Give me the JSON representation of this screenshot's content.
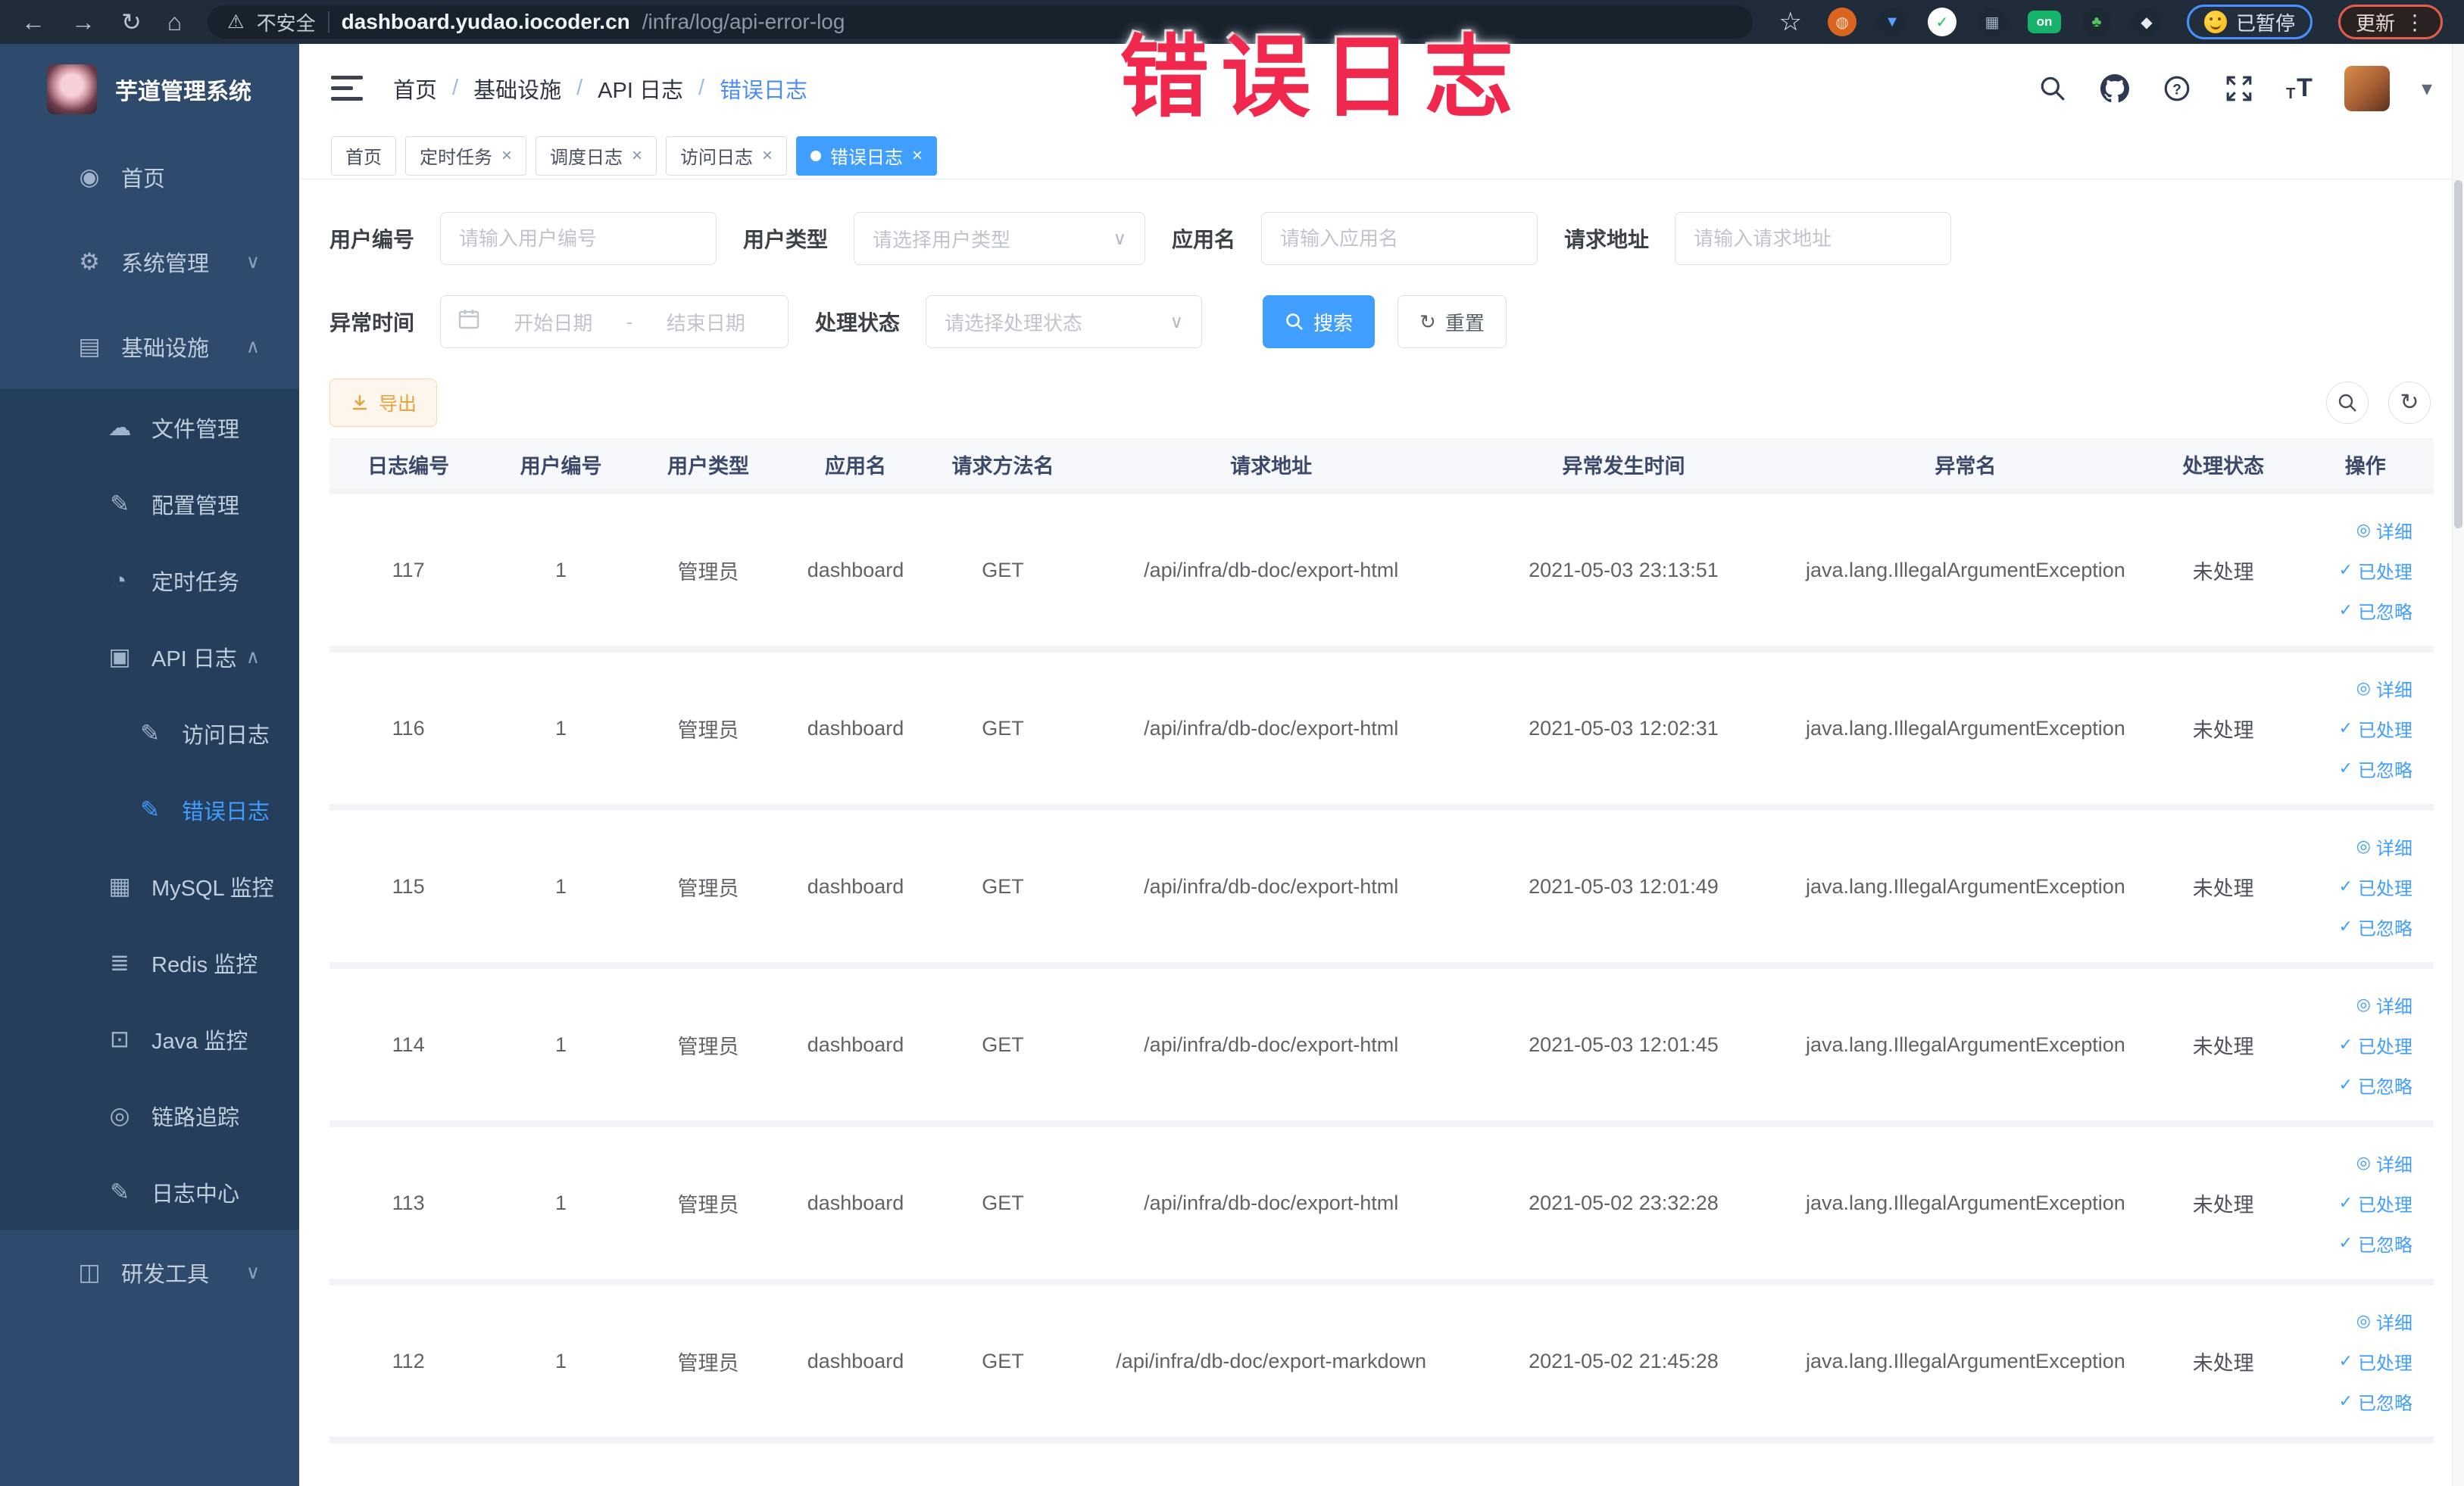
{
  "colors": {
    "primary": "#409eff",
    "warning_text": "#e6a23c",
    "warning_bg": "#fdf6ec",
    "warning_border": "#f5dab1",
    "sidebar_bg": "#2e4a6c",
    "sidebar_submenu_bg": "#243e5c",
    "browser_bar_bg": "#202c3a",
    "watermark": "#f1284d",
    "active_tab_bg": "#409eff"
  },
  "watermark": {
    "text": "错误日志"
  },
  "browser": {
    "back_glyph": "←",
    "forward_glyph": "→",
    "reload_glyph": "↻",
    "home_glyph": "⌂",
    "warning_glyph": "⚠",
    "security_label": "不安全",
    "url_host": "dashboard.yudao.iocoder.cn",
    "url_path": "/infra/log/api-error-log",
    "bookmark_star_glyph": "☆",
    "extensions": [
      {
        "name": "ext-orange-icon",
        "glyph": "◍",
        "bg": "#d9651f",
        "fg": "#ffd9c0",
        "shape": "circle"
      },
      {
        "name": "ext-shield-icon",
        "glyph": "▼",
        "bg": "#1d2935",
        "fg": "#5aa0ff",
        "shape": "circle"
      },
      {
        "name": "ext-green-check-icon",
        "glyph": "✓",
        "bg": "#ffffff",
        "fg": "#21c15c",
        "shape": "circle"
      },
      {
        "name": "ext-grid-icon",
        "glyph": "▦",
        "bg": "#1d2935",
        "fg": "#9fb2c8",
        "shape": "circle"
      },
      {
        "name": "ext-on-badge-icon",
        "glyph": "on",
        "bg": "#17b26a",
        "fg": "#ffffff",
        "shape": "badge"
      },
      {
        "name": "ext-sprout-icon",
        "glyph": "♣",
        "bg": "#1d2935",
        "fg": "#57c65f",
        "shape": "circle"
      },
      {
        "name": "ext-puzzle-icon",
        "glyph": "◆",
        "bg": "#1d2935",
        "fg": "#e8ecf1",
        "shape": "circle"
      }
    ],
    "paused_label": "已暂停",
    "update_label": "更新",
    "menu_dots_glyph": "⋮"
  },
  "sidebar": {
    "title": "芋道管理系统",
    "items": [
      {
        "key": "home",
        "label": "首页",
        "icon": "home-gauge-icon",
        "glyph": "◉",
        "depth": 0,
        "dark": false,
        "active": false,
        "chevron": null
      },
      {
        "key": "system",
        "label": "系统管理",
        "icon": "gear-icon",
        "glyph": "⚙",
        "depth": 0,
        "dark": false,
        "active": false,
        "chevron": "down"
      },
      {
        "key": "infra",
        "label": "基础设施",
        "icon": "infrastructure-icon",
        "glyph": "▤",
        "depth": 0,
        "dark": false,
        "active": false,
        "chevron": "up"
      },
      {
        "key": "file",
        "label": "文件管理",
        "icon": "cloud-upload-icon",
        "glyph": "☁",
        "depth": 1,
        "dark": true,
        "active": false,
        "chevron": null
      },
      {
        "key": "config",
        "label": "配置管理",
        "icon": "edit-square-icon",
        "glyph": "✎",
        "depth": 1,
        "dark": true,
        "active": false,
        "chevron": null
      },
      {
        "key": "job",
        "label": "定时任务",
        "icon": "timer-icon",
        "glyph": "◔",
        "depth": 1,
        "dark": true,
        "active": false,
        "chevron": null
      },
      {
        "key": "api-log",
        "label": "API 日志",
        "icon": "api-log-icon",
        "glyph": "▣",
        "depth": 1,
        "dark": true,
        "active": false,
        "chevron": "up"
      },
      {
        "key": "access-log",
        "label": "访问日志",
        "icon": "access-log-icon",
        "glyph": "✎",
        "depth": 2,
        "dark": true,
        "active": false,
        "chevron": null
      },
      {
        "key": "error-log",
        "label": "错误日志",
        "icon": "error-log-icon",
        "glyph": "✎",
        "depth": 2,
        "dark": true,
        "active": true,
        "chevron": null
      },
      {
        "key": "mysql",
        "label": "MySQL 监控",
        "icon": "mysql-monitor-icon",
        "glyph": "▦",
        "depth": 1,
        "dark": true,
        "active": false,
        "chevron": null
      },
      {
        "key": "redis",
        "label": "Redis 监控",
        "icon": "redis-monitor-icon",
        "glyph": "≣",
        "depth": 1,
        "dark": true,
        "active": false,
        "chevron": null
      },
      {
        "key": "java",
        "label": "Java 监控",
        "icon": "java-monitor-icon",
        "glyph": "⊡",
        "depth": 1,
        "dark": true,
        "active": false,
        "chevron": null
      },
      {
        "key": "trace",
        "label": "链路追踪",
        "icon": "trace-eye-icon",
        "glyph": "◎",
        "depth": 1,
        "dark": true,
        "active": false,
        "chevron": null
      },
      {
        "key": "log-center",
        "label": "日志中心",
        "icon": "log-center-icon",
        "glyph": "✎",
        "depth": 1,
        "dark": true,
        "active": false,
        "chevron": null
      },
      {
        "key": "dev-tools",
        "label": "研发工具",
        "icon": "dev-tools-icon",
        "glyph": "◫",
        "depth": 0,
        "dark": false,
        "active": false,
        "chevron": "down"
      }
    ]
  },
  "topbar": {
    "breadcrumb": [
      {
        "label": "首页",
        "current": false
      },
      {
        "label": "基础设施",
        "current": false
      },
      {
        "label": "API 日志",
        "current": false
      },
      {
        "label": "错误日志",
        "current": true
      }
    ],
    "separator": "/"
  },
  "tabs": [
    {
      "key": "home",
      "label": "首页",
      "closable": false,
      "active": false
    },
    {
      "key": "job",
      "label": "定时任务",
      "closable": true,
      "active": false
    },
    {
      "key": "job-log",
      "label": "调度日志",
      "closable": true,
      "active": false
    },
    {
      "key": "access-log",
      "label": "访问日志",
      "closable": true,
      "active": false
    },
    {
      "key": "error-log",
      "label": "错误日志",
      "closable": true,
      "active": true
    }
  ],
  "filters": {
    "user_id": {
      "label": "用户编号",
      "placeholder": "请输入用户编号"
    },
    "user_type": {
      "label": "用户类型",
      "placeholder": "请选择用户类型"
    },
    "app_name": {
      "label": "应用名",
      "placeholder": "请输入应用名"
    },
    "request_url": {
      "label": "请求地址",
      "placeholder": "请输入请求地址"
    },
    "exception_time": {
      "label": "异常时间",
      "start_placeholder": "开始日期",
      "separator": "-",
      "end_placeholder": "结束日期"
    },
    "process_status": {
      "label": "处理状态",
      "placeholder": "请选择处理状态"
    },
    "search_label": "搜索",
    "reset_label": "重置"
  },
  "toolbar": {
    "export_label": "导出"
  },
  "table": {
    "columns": [
      "日志编号",
      "用户编号",
      "用户类型",
      "应用名",
      "请求方法名",
      "请求地址",
      "异常发生时间",
      "异常名",
      "处理状态",
      "操作"
    ],
    "row_keys": [
      "id",
      "user_id",
      "user_type",
      "app",
      "method",
      "url",
      "time",
      "exception",
      "status"
    ],
    "ops": [
      {
        "label": "详细",
        "icon": "eye-icon",
        "glyph": "◎"
      },
      {
        "label": "已处理",
        "icon": "check-icon",
        "glyph": "✓"
      },
      {
        "label": "已忽略",
        "icon": "check-icon",
        "glyph": "✓"
      }
    ],
    "rows": [
      {
        "id": "117",
        "user_id": "1",
        "user_type": "管理员",
        "app": "dashboard",
        "method": "GET",
        "url": "/api/infra/db-doc/export-html",
        "time": "2021-05-03 23:13:51",
        "exception": "java.lang.IllegalArgumentException",
        "status": "未处理"
      },
      {
        "id": "116",
        "user_id": "1",
        "user_type": "管理员",
        "app": "dashboard",
        "method": "GET",
        "url": "/api/infra/db-doc/export-html",
        "time": "2021-05-03 12:02:31",
        "exception": "java.lang.IllegalArgumentException",
        "status": "未处理"
      },
      {
        "id": "115",
        "user_id": "1",
        "user_type": "管理员",
        "app": "dashboard",
        "method": "GET",
        "url": "/api/infra/db-doc/export-html",
        "time": "2021-05-03 12:01:49",
        "exception": "java.lang.IllegalArgumentException",
        "status": "未处理"
      },
      {
        "id": "114",
        "user_id": "1",
        "user_type": "管理员",
        "app": "dashboard",
        "method": "GET",
        "url": "/api/infra/db-doc/export-html",
        "time": "2021-05-03 12:01:45",
        "exception": "java.lang.IllegalArgumentException",
        "status": "未处理"
      },
      {
        "id": "113",
        "user_id": "1",
        "user_type": "管理员",
        "app": "dashboard",
        "method": "GET",
        "url": "/api/infra/db-doc/export-html",
        "time": "2021-05-02 23:32:28",
        "exception": "java.lang.IllegalArgumentException",
        "status": "未处理"
      },
      {
        "id": "112",
        "user_id": "1",
        "user_type": "管理员",
        "app": "dashboard",
        "method": "GET",
        "url": "/api/infra/db-doc/export-markdown",
        "time": "2021-05-02 21:45:28",
        "exception": "java.lang.IllegalArgumentException",
        "status": "未处理"
      }
    ]
  }
}
